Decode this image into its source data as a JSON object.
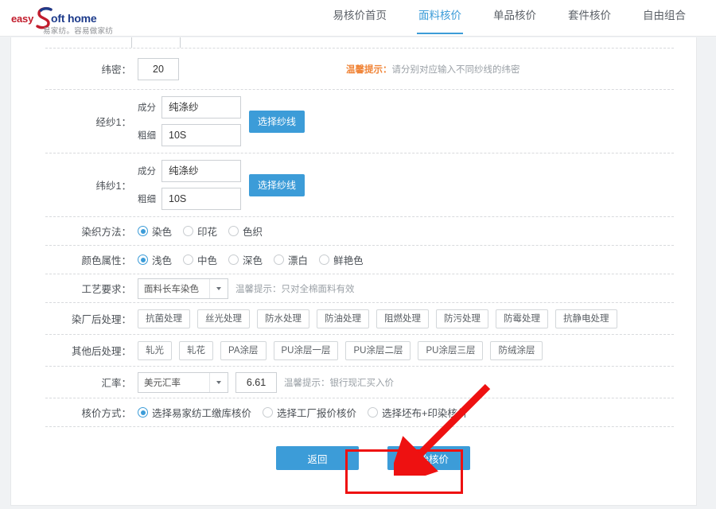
{
  "header": {
    "logo": {
      "word_left": "easy",
      "word_right": "oft home",
      "tagline": "易家纺。容易做家纺",
      "color_left": "#c21c2c",
      "color_right": "#1d3b8b"
    },
    "nav": [
      {
        "label": "易核价首页",
        "active": false
      },
      {
        "label": "面料核价",
        "active": true
      },
      {
        "label": "单品核价",
        "active": false
      },
      {
        "label": "套件核价",
        "active": false
      },
      {
        "label": "自由组合",
        "active": false
      }
    ],
    "accent_color": "#3c9cd8"
  },
  "form": {
    "weft_density": {
      "label": "纬密：",
      "value": "20",
      "tip_strong": "温馨提示：",
      "tip": "请分别对应输入不同纱线的纬密"
    },
    "warp_yarn_1": {
      "label": "经纱1：",
      "composition_label": "成分",
      "composition_value": "纯涤纱",
      "count_label": "粗细",
      "count_value": "10S",
      "button_label": "选择纱线"
    },
    "weft_yarn_1": {
      "label": "纬纱1：",
      "composition_label": "成分",
      "composition_value": "纯涤纱",
      "count_label": "粗细",
      "count_value": "10S",
      "button_label": "选择纱线"
    },
    "dye_method": {
      "label": "染织方法：",
      "options": [
        {
          "label": "染色",
          "selected": true
        },
        {
          "label": "印花",
          "selected": false
        },
        {
          "label": "色织",
          "selected": false
        }
      ]
    },
    "color_property": {
      "label": "颜色属性：",
      "options": [
        {
          "label": "浅色",
          "selected": true
        },
        {
          "label": "中色",
          "selected": false
        },
        {
          "label": "深色",
          "selected": false
        },
        {
          "label": "漂白",
          "selected": false
        },
        {
          "label": "鲜艳色",
          "selected": false
        }
      ]
    },
    "process_requirement": {
      "label": "工艺要求：",
      "selected": "面料长车染色",
      "tip": "温馨提示：只对全棉面料有效"
    },
    "dye_house_finishing": {
      "label": "染厂后处理：",
      "tags": [
        "抗菌处理",
        "丝光处理",
        "防水处理",
        "防油处理",
        "阻燃处理",
        "防污处理",
        "防霉处理",
        "抗静电处理"
      ]
    },
    "other_finishing": {
      "label": "其他后处理：",
      "tags": [
        "轧光",
        "轧花",
        "PA涂层",
        "PU涂层一层",
        "PU涂层二层",
        "PU涂层三层",
        "防绒涂层"
      ]
    },
    "exchange_rate": {
      "label": "汇率：",
      "currency_selected": "美元汇率",
      "value": "6.61",
      "tip": "温馨提示：银行现汇买入价"
    },
    "pricing_method": {
      "label": "核价方式：",
      "options": [
        {
          "label": "选择易家纺工缴库核价",
          "selected": true
        },
        {
          "label": "选择工厂报价核价",
          "selected": false
        },
        {
          "label": "选择坯布+印染核价",
          "selected": false
        }
      ]
    },
    "actions": {
      "back_label": "返回",
      "start_label": "开始核价"
    }
  },
  "annotation": {
    "highlight_color": "#ee1111",
    "highlight_target": "开始核价"
  }
}
